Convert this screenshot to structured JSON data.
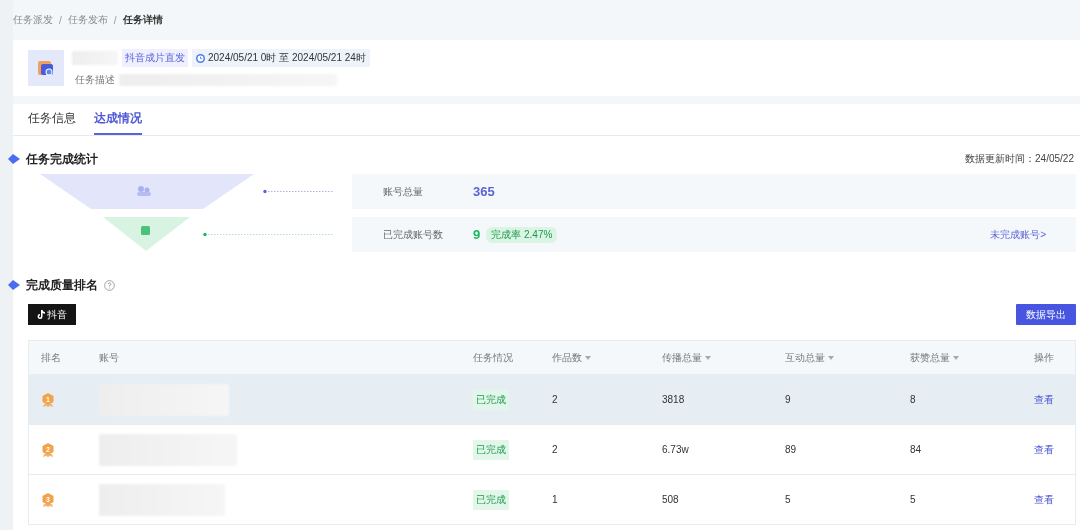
{
  "breadcrumb": [
    {
      "label": "任务派发",
      "current": false
    },
    {
      "label": "任务发布",
      "current": false
    },
    {
      "label": "任务详情",
      "current": true
    }
  ],
  "breadcrumb_separator": "/",
  "task": {
    "tag": "抖音成片直发",
    "period": "2024/05/21 0时 至 2024/05/21 24时",
    "description_label": "任务描述"
  },
  "tabs": [
    {
      "label": "任务信息",
      "selected": false
    },
    {
      "label": "达成情况",
      "selected": true
    }
  ],
  "completion_stats": {
    "title": "任务完成统计",
    "updated": "数据更新时间：24/05/22",
    "stages": [
      {
        "kind": "total",
        "label": "账号总量",
        "value": "365",
        "color": "#5b63d8"
      },
      {
        "kind": "done",
        "label": "已完成账号数",
        "value": "9",
        "rate": "完成率 2.47%",
        "link": "未完成账号>",
        "color": "#1bb55c"
      }
    ]
  },
  "ranking": {
    "title": "完成质量排名",
    "platform_button": "抖音",
    "export_button": "数据导出",
    "columns": [
      {
        "label": "排名",
        "sortable": false
      },
      {
        "label": "账号",
        "sortable": false
      },
      {
        "label": "任务情况",
        "sortable": false
      },
      {
        "label": "作品数",
        "sortable": true
      },
      {
        "label": "传播总量",
        "sortable": true
      },
      {
        "label": "互动总量",
        "sortable": true
      },
      {
        "label": "获赞总量",
        "sortable": true
      },
      {
        "label": "操作",
        "sortable": false
      }
    ],
    "rows": [
      {
        "rank": "1",
        "status": "已完成",
        "works": "2",
        "spread": "3818",
        "interactions": "9",
        "likes": "8",
        "action": "查看",
        "highlighted": true
      },
      {
        "rank": "2",
        "status": "已完成",
        "works": "2",
        "spread": "6.73w",
        "interactions": "89",
        "likes": "84",
        "action": "查看",
        "highlighted": false
      },
      {
        "rank": "3",
        "status": "已完成",
        "works": "1",
        "spread": "508",
        "interactions": "5",
        "likes": "5",
        "action": "查看",
        "highlighted": false
      }
    ]
  }
}
